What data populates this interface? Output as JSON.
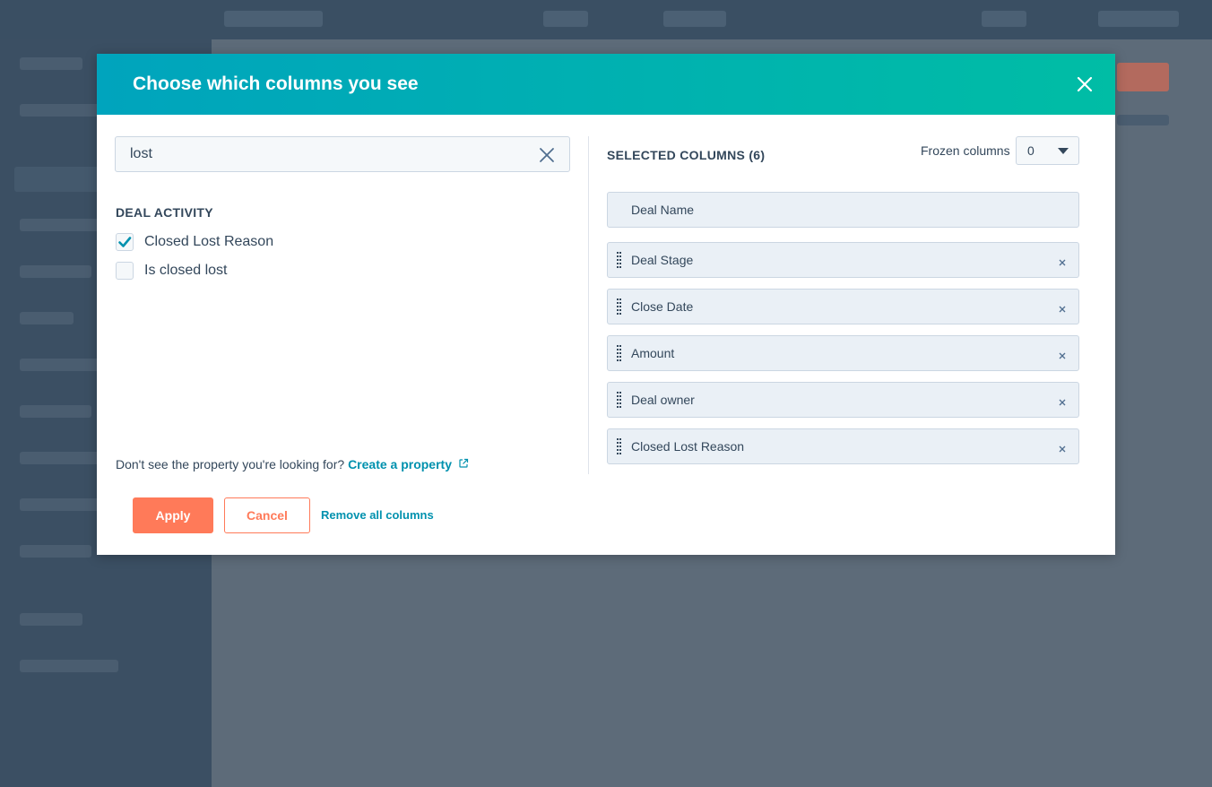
{
  "modal": {
    "title": "Choose which columns you see",
    "search": {
      "value": "lost"
    },
    "group": {
      "heading": "DEAL ACTIVITY",
      "options": [
        {
          "label": "Closed Lost Reason",
          "checked": true
        },
        {
          "label": "Is closed lost",
          "checked": false
        }
      ]
    },
    "help": {
      "text": "Don't see the property you're looking for?",
      "link": "Create a property"
    },
    "selected": {
      "heading": "SELECTED COLUMNS (6)",
      "frozen_label": "Frozen columns",
      "frozen_value": "0",
      "columns": [
        {
          "label": "Deal Name",
          "locked": true
        },
        {
          "label": "Deal Stage",
          "locked": false
        },
        {
          "label": "Close Date",
          "locked": false
        },
        {
          "label": "Amount",
          "locked": false
        },
        {
          "label": "Deal owner",
          "locked": false
        },
        {
          "label": "Closed Lost Reason",
          "locked": false
        }
      ]
    },
    "footer": {
      "apply": "Apply",
      "cancel": "Cancel",
      "remove_all": "Remove all columns"
    }
  },
  "colors": {
    "header_start": "#00a4bd",
    "header_end": "#00bda5",
    "primary_button": "#ff7a59",
    "link": "#0091ae",
    "text": "#33475b"
  }
}
